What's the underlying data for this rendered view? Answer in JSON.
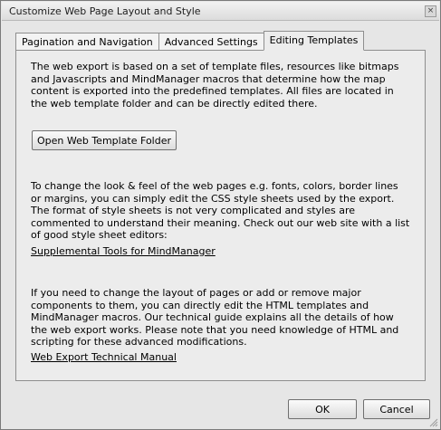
{
  "window": {
    "title": "Customize Web Page Layout and Style",
    "close_glyph": "×"
  },
  "tabs": [
    {
      "label": "Pagination and Navigation",
      "active": false
    },
    {
      "label": "Advanced Settings",
      "active": false
    },
    {
      "label": "Editing Templates",
      "active": true
    }
  ],
  "panel": {
    "intro_text": "The web export is based on a set of template files, resources like bitmaps and Javascripts and MindManager macros that determine how the map content is exported into the predefined templates. All files are located in the web template folder and can be directly edited there.",
    "open_folder_button": "Open Web Template Folder",
    "css_text": "To change the look & feel of the web pages e.g. fonts, colors, border lines or margins, you can simply edit the CSS style sheets used by the export. The format of style sheets is not very complicated and styles are commented to understand their meaning. Check out our web site with a list of good style sheet editors:",
    "tools_link": "Supplemental Tools for MindManager",
    "html_text": "If you need to change the layout of pages or add or remove major components to them, you can directly edit the HTML templates and MindManager macros. Our technical guide explains all the details of how the web export works. Please note that you need knowledge of HTML and scripting for these advanced modifications.",
    "manual_link": "Web Export Technical Manual"
  },
  "footer": {
    "ok_label": "OK",
    "cancel_label": "Cancel"
  }
}
